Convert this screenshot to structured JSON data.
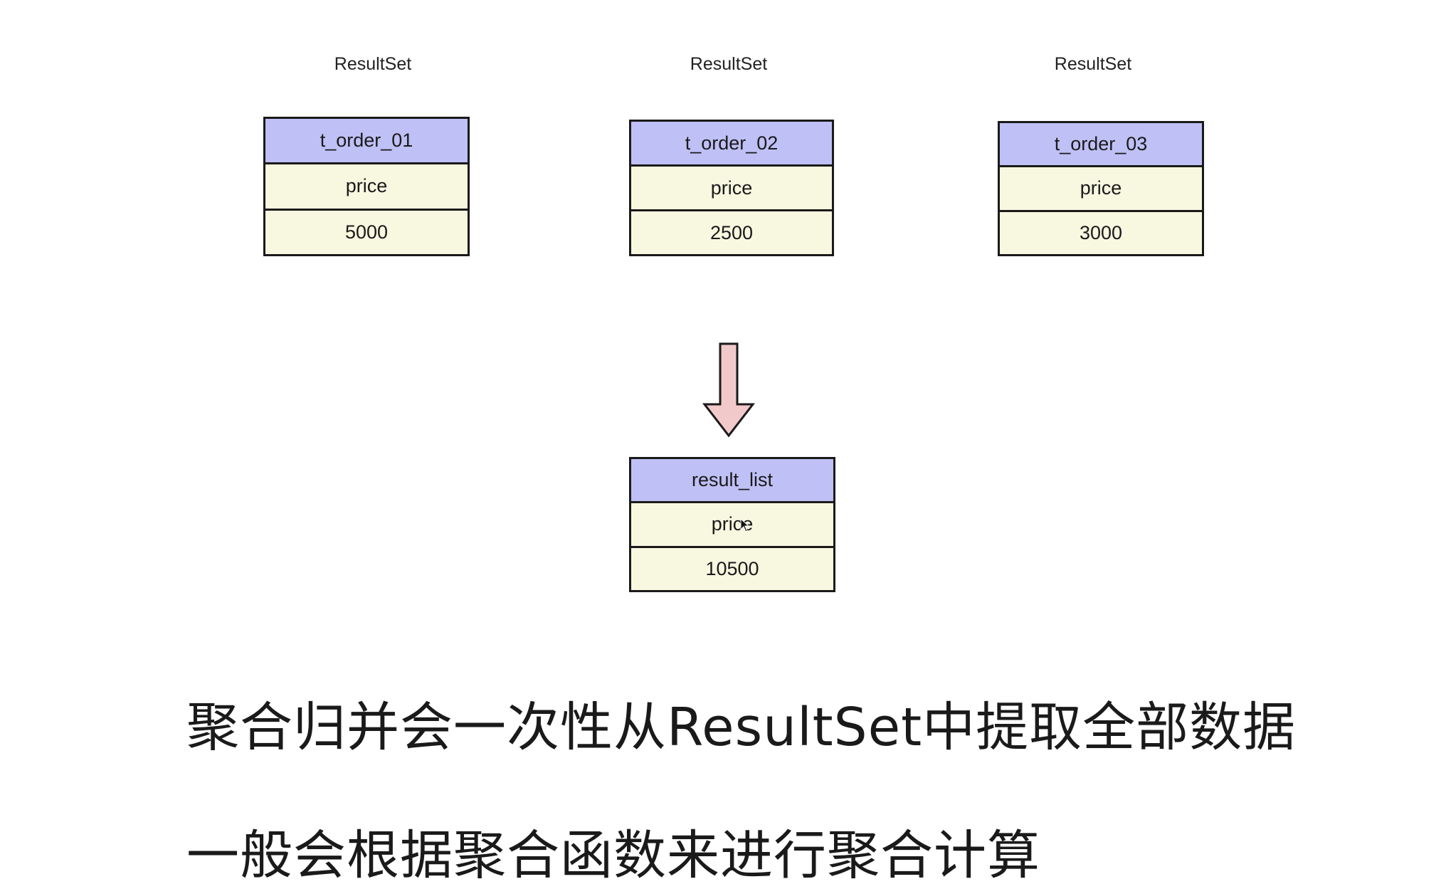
{
  "tables": [
    {
      "label": "ResultSet",
      "header": "t_order_01",
      "field": "price",
      "value": "5000"
    },
    {
      "label": "ResultSet",
      "header": "t_order_02",
      "field": "price",
      "value": "2500"
    },
    {
      "label": "ResultSet",
      "header": "t_order_03",
      "field": "price",
      "value": "3000"
    }
  ],
  "result": {
    "header": "result_list",
    "field": "price",
    "value": "10500"
  },
  "captions": [
    "聚合归并会一次性从ResultSet中提取全部数据",
    "一般会根据聚合函数来进行聚合计算"
  ],
  "icons": {
    "arrow": "down-arrow-icon",
    "cursor": "mouse-cursor-icon"
  },
  "colors": {
    "header_fill": "#bfc0f5",
    "body_fill": "#f8f7e0",
    "arrow_fill": "#f2c9cb"
  }
}
